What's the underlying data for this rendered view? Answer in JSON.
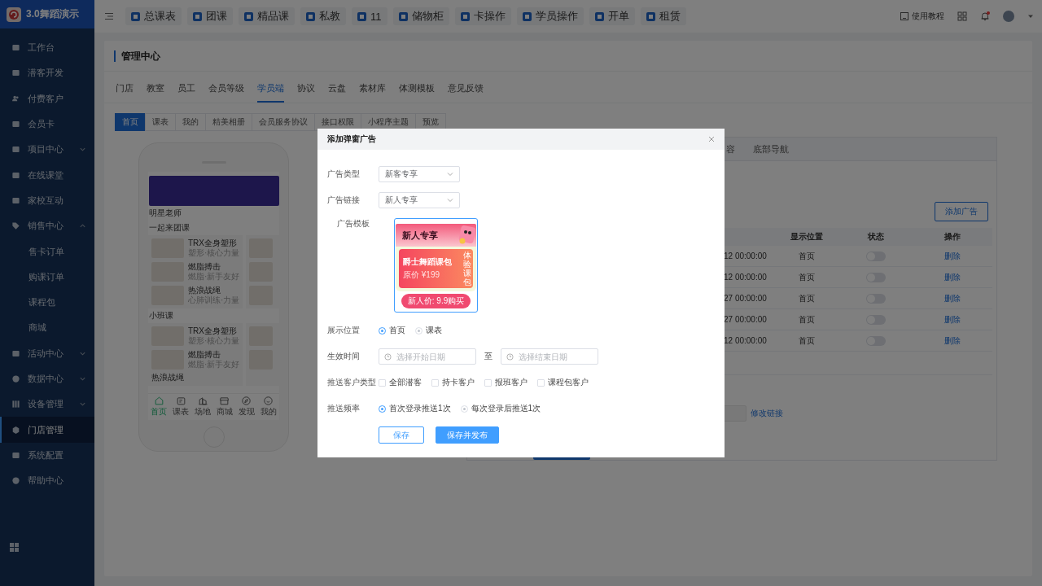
{
  "sidebar": {
    "brand": "3.0舞蹈演示",
    "items": [
      {
        "label": "工作台",
        "kind": "link",
        "selected": false
      },
      {
        "label": "潜客开发",
        "kind": "link",
        "selected": false
      },
      {
        "label": "付费客户",
        "kind": "link",
        "selected": false
      },
      {
        "label": "会员卡",
        "kind": "link",
        "selected": false
      },
      {
        "label": "项目中心",
        "kind": "group",
        "expanded": false,
        "selected": false
      },
      {
        "label": "在线课堂",
        "kind": "link",
        "selected": false
      },
      {
        "label": "家校互动",
        "kind": "link",
        "selected": false
      },
      {
        "label": "销售中心",
        "kind": "group",
        "expanded": true,
        "selected": false,
        "children": [
          {
            "label": "售卡订单",
            "selected": false
          },
          {
            "label": "购课订单",
            "selected": false
          },
          {
            "label": "课程包",
            "selected": false
          },
          {
            "label": "商城",
            "selected": false
          }
        ]
      },
      {
        "label": "活动中心",
        "kind": "group",
        "expanded": false,
        "selected": false
      },
      {
        "label": "数据中心",
        "kind": "group",
        "expanded": false,
        "selected": false
      },
      {
        "label": "设备管理",
        "kind": "group",
        "expanded": false,
        "selected": false
      },
      {
        "label": "门店管理",
        "kind": "link",
        "selected": true
      },
      {
        "label": "系统配置",
        "kind": "link",
        "selected": false
      },
      {
        "label": "帮助中心",
        "kind": "link",
        "selected": false
      }
    ]
  },
  "topbar": {
    "shortcuts": [
      "总课表",
      "团课",
      "精品课",
      "私教",
      "11",
      "储物柜",
      "卡操作",
      "学员操作",
      "开单",
      "租赁"
    ],
    "help": "使用教程"
  },
  "page": {
    "title": "管理中心",
    "tabs": [
      {
        "label": "门店",
        "selected": false
      },
      {
        "label": "教室",
        "selected": false
      },
      {
        "label": "员工",
        "selected": false
      },
      {
        "label": "会员等级",
        "selected": false
      },
      {
        "label": "学员端",
        "selected": true
      },
      {
        "label": "协议",
        "selected": false
      },
      {
        "label": "云盘",
        "selected": false
      },
      {
        "label": "素材库",
        "selected": false
      },
      {
        "label": "体测模板",
        "selected": false
      },
      {
        "label": "意见反馈",
        "selected": false
      }
    ],
    "subtabs": [
      {
        "label": "首页",
        "selected": true
      },
      {
        "label": "课表",
        "selected": false
      },
      {
        "label": "我的",
        "selected": false
      },
      {
        "label": "精美相册",
        "selected": false
      },
      {
        "label": "会员服务协议",
        "selected": false
      },
      {
        "label": "接口权限",
        "selected": false
      },
      {
        "label": "小程序主题",
        "selected": false
      },
      {
        "label": "预览",
        "selected": false
      }
    ]
  },
  "phone": {
    "teacher_heading": "明星老师",
    "sections": [
      {
        "title": "一起来团课",
        "courses": [
          {
            "title": "TRX全身塑形",
            "subtitle": "塑形·核心力量"
          },
          {
            "title": "燃脂搏击",
            "subtitle": "燃脂·新手友好"
          },
          {
            "title": "热浪战绳",
            "subtitle": "心肺训练·力量"
          }
        ]
      },
      {
        "title": "小班课",
        "courses": [
          {
            "title": "TRX全身塑形",
            "subtitle": "塑形·核心力量"
          },
          {
            "title": "燃脂搏击",
            "subtitle": "燃脂·新手友好"
          },
          {
            "title": "热浪战绳"
          }
        ]
      }
    ],
    "nav": [
      {
        "label": "首页",
        "selected": true
      },
      {
        "label": "课表",
        "selected": false
      },
      {
        "label": "场地",
        "selected": false
      },
      {
        "label": "商城",
        "selected": false
      },
      {
        "label": "发现",
        "selected": false
      },
      {
        "label": "我的",
        "selected": false
      }
    ]
  },
  "ad_panel": {
    "tabs": [
      {
        "label": "容",
        "selected": false
      },
      {
        "label": "底部导航",
        "selected": false
      }
    ],
    "add_button": "添加广告",
    "columns": [
      "显示位置",
      "状态",
      "操作"
    ],
    "rows": [
      {
        "time": "12 00:00:00",
        "position": "首页",
        "on": false,
        "action": "删除"
      },
      {
        "time": "12 00:00:00",
        "position": "首页",
        "on": false,
        "action": "删除"
      },
      {
        "time": "27 00:00:00",
        "position": "首页",
        "on": false,
        "action": "删除"
      },
      {
        "time": "27 00:00:00",
        "position": "首页",
        "on": false,
        "action": "删除"
      },
      {
        "time": "12 00:00:00",
        "position": "首页",
        "on": false,
        "action": "删除"
      }
    ],
    "link": "修改链接"
  },
  "dialog": {
    "title": "添加弹窗广告",
    "fields": [
      {
        "kind": "select",
        "label": "广告类型",
        "value": "新客专享"
      },
      {
        "kind": "select",
        "label": "广告链接",
        "value": "新人专享"
      },
      {
        "kind": "template",
        "label": "广告模板",
        "template": {
          "heading": "新人专享",
          "package": "爵士舞蹈课包",
          "original_price": "原价 ¥199",
          "tag": "体验课包",
          "cta": "新人价: 9.9购买"
        }
      },
      {
        "kind": "radio",
        "label": "展示位置",
        "options": [
          {
            "label": "首页",
            "selected": true
          },
          {
            "label": "课表",
            "selected": false
          }
        ]
      },
      {
        "kind": "daterange",
        "label": "生效时间",
        "start_placeholder": "选择开始日期",
        "separator": "至",
        "end_placeholder": "选择结束日期"
      },
      {
        "kind": "checkbox",
        "label": "推送客户类型",
        "options": [
          {
            "label": "全部潜客",
            "checked": false
          },
          {
            "label": "持卡客户",
            "checked": false
          },
          {
            "label": "报班客户",
            "checked": false
          },
          {
            "label": "课程包客户",
            "checked": false
          }
        ]
      },
      {
        "kind": "radio",
        "label": "推送频率",
        "options": [
          {
            "label": "首次登录推送1次",
            "selected": true
          },
          {
            "label": "每次登录后推送1次",
            "selected": false
          }
        ]
      }
    ],
    "buttons": [
      {
        "label": "保存",
        "kind": "secondary"
      },
      {
        "label": "保存并发布",
        "kind": "primary"
      }
    ]
  }
}
